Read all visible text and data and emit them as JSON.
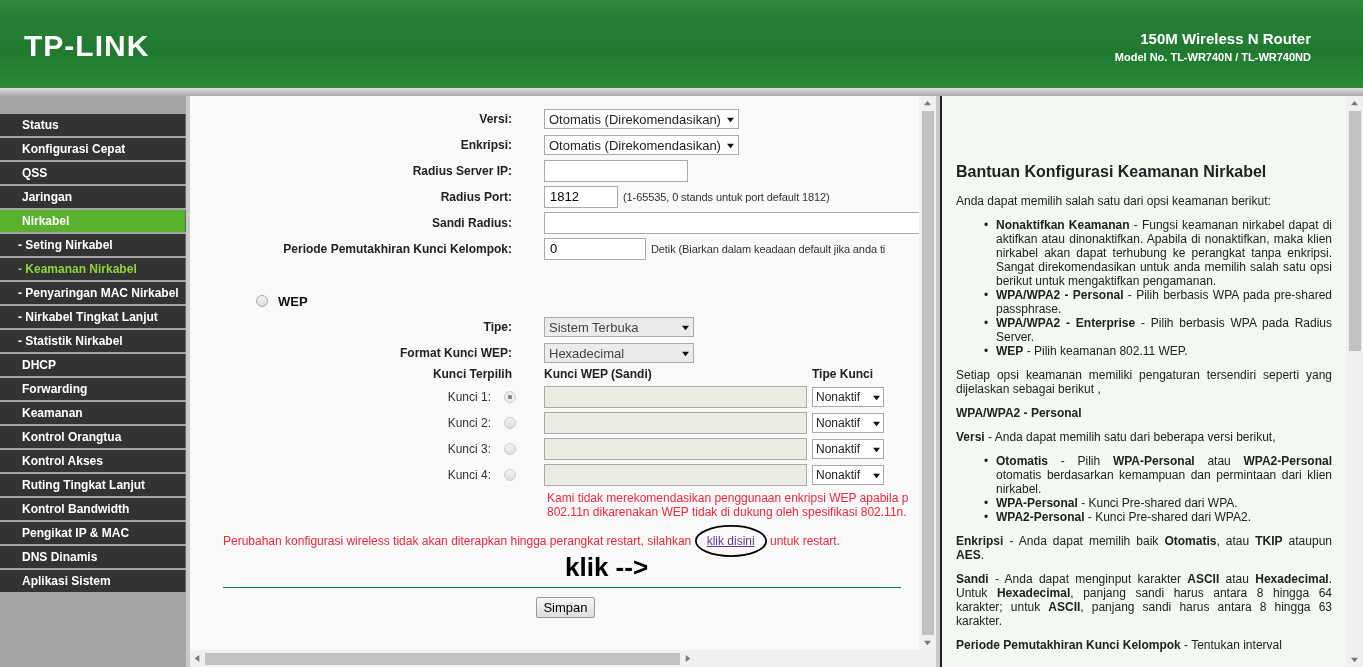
{
  "header": {
    "logo": "TP-LINK",
    "product": "150M Wireless N Router",
    "model": "Model No. TL-WR740N / TL-WR740ND"
  },
  "sidebar": {
    "items": [
      {
        "label": "Status",
        "selected": false
      },
      {
        "label": "Konfigurasi Cepat",
        "selected": false
      },
      {
        "label": "QSS",
        "selected": false
      },
      {
        "label": "Jaringan",
        "selected": false
      },
      {
        "label": "Nirkabel",
        "selected": true,
        "children": [
          {
            "label": "- Seting Nirkabel",
            "selected": false
          },
          {
            "label": "- Keamanan Nirkabel",
            "selected": true
          },
          {
            "label": "- Penyaringan MAC Nirkabel",
            "selected": false
          },
          {
            "label": "- Nirkabel Tingkat Lanjut",
            "selected": false
          },
          {
            "label": "- Statistik Nirkabel",
            "selected": false
          }
        ]
      },
      {
        "label": "DHCP",
        "selected": false
      },
      {
        "label": "Forwarding",
        "selected": false
      },
      {
        "label": "Keamanan",
        "selected": false
      },
      {
        "label": "Kontrol Orangtua",
        "selected": false
      },
      {
        "label": "Kontrol Akses",
        "selected": false
      },
      {
        "label": "Ruting Tingkat Lanjut",
        "selected": false
      },
      {
        "label": "Kontrol Bandwidth",
        "selected": false
      },
      {
        "label": "Pengikat IP & MAC",
        "selected": false
      },
      {
        "label": "DNS Dinamis",
        "selected": false
      },
      {
        "label": "Aplikasi Sistem",
        "selected": false
      }
    ]
  },
  "enterprise_fields": [
    {
      "kind": "select",
      "label": "Versi:",
      "value": "Otomatis (Direkomendasikan)"
    },
    {
      "kind": "select",
      "label": "Enkripsi:",
      "value": "Otomatis (Direkomendasikan)"
    },
    {
      "kind": "input",
      "label": "Radius Server IP:"
    },
    {
      "kind": "short-input",
      "label": "Radius Port:",
      "value": "1812",
      "note": "(1-65535, 0 stands untuk port default 1812)"
    },
    {
      "kind": "wide-input",
      "label": "Sandi Radius:"
    },
    {
      "kind": "medium-input",
      "label": "Periode Pemutakhiran Kunci Kelompok:",
      "value": "0",
      "note": "Detik (Biarkan dalam keadaan default jika anda ti"
    }
  ],
  "wep": {
    "label": "WEP",
    "selected": false,
    "disabled": true,
    "fields": [
      {
        "kind": "select",
        "label": "Tipe:",
        "value": "Sistem Terbuka"
      },
      {
        "kind": "select",
        "label": "Format Kunci WEP:",
        "value": "Hexadecimal"
      }
    ],
    "key_table": {
      "columns": [
        "Kunci Terpilih",
        "Kunci WEP (Sandi)",
        "Tipe Kunci"
      ],
      "rows": [
        {
          "label": "Kunci 1:",
          "selected": true,
          "type": "Nonaktif"
        },
        {
          "label": "Kunci 2:",
          "selected": false,
          "type": "Nonaktif"
        },
        {
          "label": "Kunci 3:",
          "selected": false,
          "type": "Nonaktif"
        },
        {
          "label": "Kunci 4:",
          "selected": false,
          "type": "Nonaktif"
        }
      ]
    },
    "warning": [
      "Kami tidak merekomendasikan penggunaan enkripsi WEP apabila p",
      "802.11n dikarenakan WEP tidak di dukung oleh spesifikasi 802.11n."
    ]
  },
  "restart_notice": {
    "before": "Perubahan konfigurasi wireless tidak akan diterapkan hingga perangkat restart, silahkan",
    "link": "klik disini",
    "after": "untuk restart."
  },
  "annotation": {
    "text": "klik -->"
  },
  "save_button": "Simpan",
  "help": {
    "title": "Bantuan Konfigurasi Keamanan Nirkabel",
    "blocks": [
      {
        "kind": "paragraph",
        "text": "Anda dapat memilih salah satu dari opsi keamanan berikut:"
      },
      {
        "kind": "list",
        "marker": "•",
        "items": [
          "**Nonaktifkan Keamanan** - Fungsi keamanan nirkabel dapat di aktifkan atau dinonaktifkan. Apabila di nonaktifkan, maka klien nirkabel akan dapat terhubung ke perangkat tanpa enkripsi. Sangat direkomendasikan untuk anda memilih salah satu opsi berikut untuk mengaktifkan pengamanan.",
          "**WPA/WPA2 - Personal** - Pilih berbasis WPA pada pre-shared passphrase.",
          "**WPA/WPA2 - Enterprise** - Pilih berbasis WPA pada Radius Server.",
          "**WEP** - Pilih keamanan 802.11 WEP."
        ]
      },
      {
        "kind": "paragraph",
        "text": "Setiap opsi keamanan memiliki pengaturan tersendiri seperti yang dijelaskan sebagai berikut ,"
      },
      {
        "kind": "heading",
        "text": "WPA/WPA2 - Personal"
      },
      {
        "kind": "paragraph",
        "text": "**Versi** -  Anda dapat memilih satu dari beberapa versi berikut,"
      },
      {
        "kind": "list",
        "marker": "•",
        "items": [
          "**Otomatis** - Pilih **WPA-Personal** atau **WPA2-Personal** otomatis berdasarkan kemampuan dan permintaan dari klien nirkabel.",
          "**WPA-Personal** - Kunci Pre-shared dari WPA.",
          "**WPA2-Personal** - Kunci Pre-shared dari WPA2."
        ]
      },
      {
        "kind": "paragraph",
        "text": "**Enkripsi** - Anda dapat memilih baik **Otomatis**, atau **TKIP** ataupun **AES**."
      },
      {
        "kind": "paragraph",
        "text": "**Sandi** - Anda dapat menginput karakter **ASCII** atau **Hexadecimal**. Untuk **Hexadecimal**, panjang sandi harus antara 8 hingga 64 karakter; untuk **ASCII**, panjang sandi harus antara 8 hingga 63 karakter."
      },
      {
        "kind": "paragraph",
        "text": "**Periode Pemutakhiran Kunci Kelompok** - Tentukan interval"
      }
    ]
  }
}
